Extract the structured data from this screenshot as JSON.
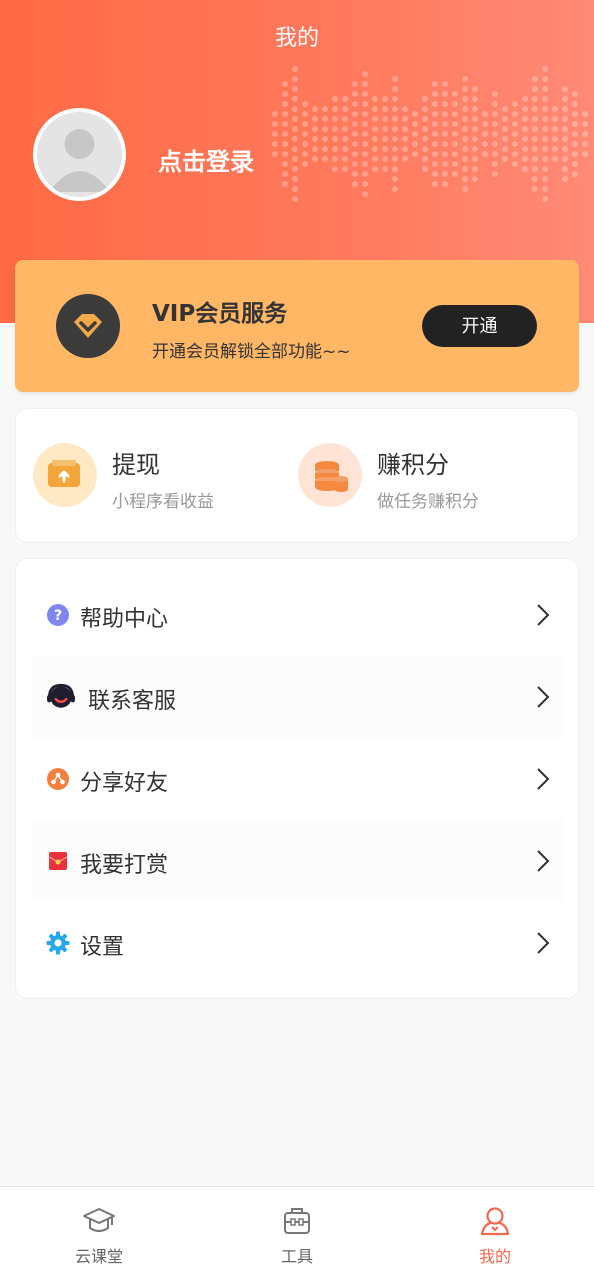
{
  "header": {
    "title": "我的"
  },
  "profile": {
    "login_text": "点击登录"
  },
  "vip": {
    "title": "VIP会员服务",
    "subtitle": "开通会员解锁全部功能~~",
    "button": "开通"
  },
  "quick_actions": [
    {
      "title": "提现",
      "subtitle": "小程序看收益",
      "icon": "wallet-icon"
    },
    {
      "title": "赚积分",
      "subtitle": "做任务赚积分",
      "icon": "coins-icon"
    }
  ],
  "menu": [
    {
      "label": "帮助中心",
      "icon": "help-icon"
    },
    {
      "label": "联系客服",
      "icon": "customer-service-icon"
    },
    {
      "label": "分享好友",
      "icon": "share-icon"
    },
    {
      "label": "我要打赏",
      "icon": "red-envelope-icon"
    },
    {
      "label": "设置",
      "icon": "gear-icon"
    }
  ],
  "tabbar": [
    {
      "label": "云课堂",
      "icon": "graduation-cap-icon",
      "active": false
    },
    {
      "label": "工具",
      "icon": "toolbox-icon",
      "active": false
    },
    {
      "label": "我的",
      "icon": "user-icon",
      "active": true
    }
  ],
  "colors": {
    "header_gradient_start": "#ff6a44",
    "header_gradient_end": "#ff8a75",
    "vip_card": "#ffb766",
    "active_tab": "#f06a50"
  }
}
